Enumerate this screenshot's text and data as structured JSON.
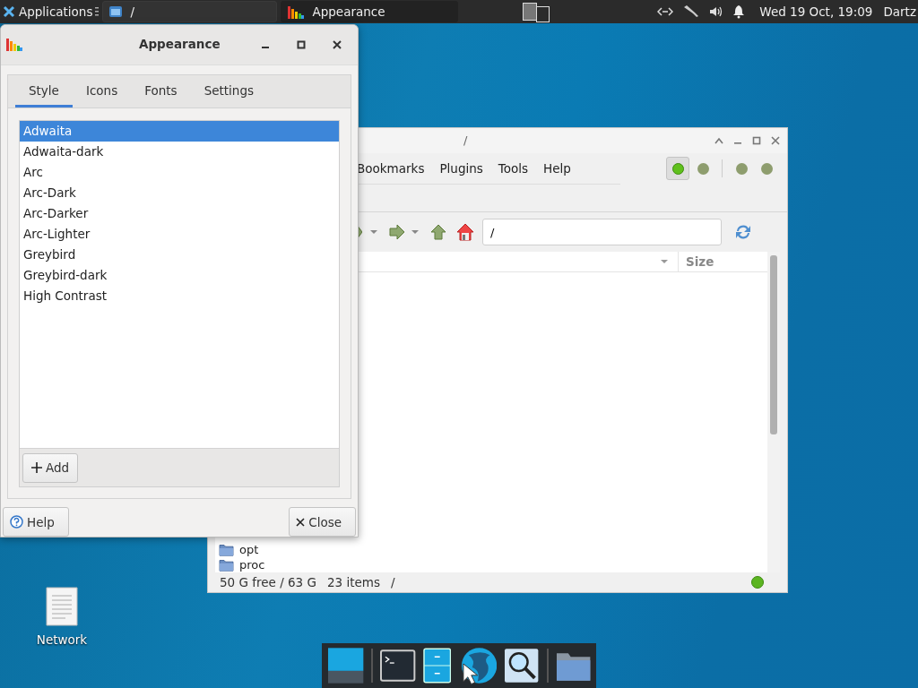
{
  "panel": {
    "applications_menu": "Applications",
    "tasks": [
      {
        "title": "/",
        "selected": false
      },
      {
        "title": "Appearance",
        "selected": true
      }
    ],
    "clock": "Wed 19 Oct, 19:09",
    "user": "Dartz"
  },
  "file_manager": {
    "title": "/",
    "menu": [
      "Bookmarks",
      "Plugins",
      "Tools",
      "Help"
    ],
    "view_buttons": [
      {
        "selected": true
      },
      {
        "selected": false
      },
      {
        "selected": false
      },
      {
        "selected": false
      }
    ],
    "location": "/",
    "columns": [
      "Size"
    ],
    "files": [
      "opt",
      "proc"
    ],
    "status": {
      "free_space": "50 G free / 63 G",
      "item_count": "23 items",
      "path": "/"
    }
  },
  "appearance_dialog": {
    "title": "Appearance",
    "tabs": [
      {
        "label": "Style",
        "selected": true
      },
      {
        "label": "Icons",
        "selected": false
      },
      {
        "label": "Fonts",
        "selected": false
      },
      {
        "label": "Settings",
        "selected": false
      }
    ],
    "themes": [
      {
        "name": "Adwaita",
        "selected": true
      },
      {
        "name": "Adwaita-dark",
        "selected": false
      },
      {
        "name": "Arc",
        "selected": false
      },
      {
        "name": "Arc-Dark",
        "selected": false
      },
      {
        "name": "Arc-Darker",
        "selected": false
      },
      {
        "name": "Arc-Lighter",
        "selected": false
      },
      {
        "name": "Greybird",
        "selected": false
      },
      {
        "name": "Greybird-dark",
        "selected": false
      },
      {
        "name": "High Contrast",
        "selected": false
      }
    ],
    "add_button": "Add",
    "help_button": "Help",
    "close_button": "Close"
  },
  "desktop_icons": [
    {
      "label": "Network"
    }
  ]
}
